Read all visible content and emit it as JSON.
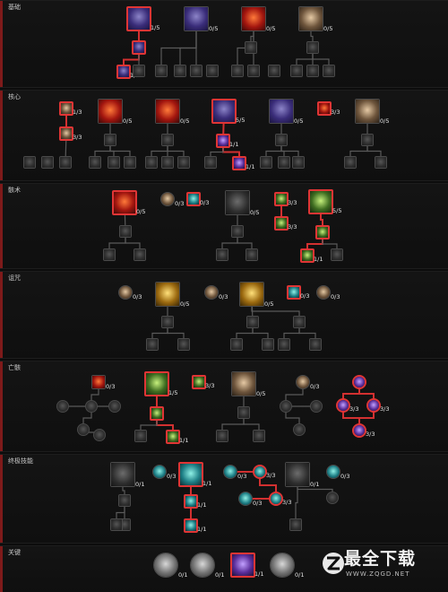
{
  "sections": [
    {
      "id": "basic",
      "title": "基础",
      "nodes": [
        {
          "id": "b1",
          "t": "blue",
          "s": "big",
          "on": true,
          "rank": "1/5"
        },
        {
          "id": "b2",
          "t": "blue",
          "s": "big",
          "rank": "0/5"
        },
        {
          "id": "b3",
          "t": "red",
          "s": "big",
          "rank": "0/5"
        },
        {
          "id": "b4",
          "t": "bronze",
          "s": "big",
          "rank": "0/5"
        },
        {
          "id": "b5",
          "t": "blue",
          "s": "med",
          "on": true
        },
        {
          "id": "b6",
          "t": "blue",
          "s": "med",
          "on": true,
          "rank": "1/1"
        },
        {
          "id": "b7",
          "t": "grey",
          "s": "small"
        },
        {
          "id": "b8",
          "t": "grey",
          "s": "small"
        },
        {
          "id": "b9",
          "t": "grey",
          "s": "small"
        },
        {
          "id": "b10",
          "t": "grey",
          "s": "small"
        },
        {
          "id": "b11",
          "t": "grey",
          "s": "small"
        },
        {
          "id": "b12",
          "t": "grey",
          "s": "small"
        },
        {
          "id": "b13",
          "t": "grey",
          "s": "small"
        },
        {
          "id": "b14",
          "t": "grey",
          "s": "small"
        },
        {
          "id": "b15",
          "t": "grey",
          "s": "small"
        },
        {
          "id": "b16",
          "t": "grey",
          "s": "small"
        },
        {
          "id": "b17",
          "t": "grey",
          "s": "small"
        },
        {
          "id": "b18",
          "t": "grey",
          "s": "small"
        },
        {
          "id": "b19",
          "t": "grey",
          "s": "small"
        }
      ]
    },
    {
      "id": "core",
      "title": "核心",
      "nodes": [
        {
          "id": "c1",
          "t": "bronze",
          "s": "med",
          "on": true,
          "rank": "1/3"
        },
        {
          "id": "c2",
          "t": "bronze",
          "s": "med",
          "on": true,
          "rank": "3/3"
        },
        {
          "id": "c3",
          "t": "red",
          "s": "big",
          "rank": "0/5"
        },
        {
          "id": "c4",
          "t": "red",
          "s": "big",
          "rank": "0/5"
        },
        {
          "id": "c5",
          "t": "blue",
          "s": "big",
          "on": true,
          "rank": "5/5"
        },
        {
          "id": "c6",
          "t": "blue",
          "s": "big",
          "rank": "0/5"
        },
        {
          "id": "c7",
          "t": "red",
          "s": "med",
          "on": true,
          "rank": "3/3"
        },
        {
          "id": "c8",
          "t": "bronze",
          "s": "big",
          "rank": "0/5"
        },
        {
          "id": "c9",
          "t": "purple",
          "s": "med",
          "on": true,
          "rank": "1/1"
        },
        {
          "id": "c10",
          "t": "purple",
          "s": "med",
          "on": true,
          "rank": "1/1"
        },
        {
          "id": "c11",
          "t": "grey",
          "s": "small"
        },
        {
          "id": "c12",
          "t": "grey",
          "s": "small"
        },
        {
          "id": "c13",
          "t": "grey",
          "s": "small"
        },
        {
          "id": "c14",
          "t": "grey",
          "s": "small"
        },
        {
          "id": "c15",
          "t": "grey",
          "s": "small"
        },
        {
          "id": "c16",
          "t": "grey",
          "s": "small"
        },
        {
          "id": "c17",
          "t": "grey",
          "s": "small"
        },
        {
          "id": "c18",
          "t": "grey",
          "s": "small"
        },
        {
          "id": "c19",
          "t": "grey",
          "s": "small"
        },
        {
          "id": "c20",
          "t": "grey",
          "s": "small"
        },
        {
          "id": "c21",
          "t": "grey",
          "s": "small"
        },
        {
          "id": "c22",
          "t": "grey",
          "s": "small"
        },
        {
          "id": "c23",
          "t": "grey",
          "s": "small"
        },
        {
          "id": "c24",
          "t": "grey",
          "s": "small"
        },
        {
          "id": "c25",
          "t": "grey",
          "s": "small"
        },
        {
          "id": "c26",
          "t": "grey",
          "s": "small"
        },
        {
          "id": "c27",
          "t": "grey",
          "s": "small"
        },
        {
          "id": "c28",
          "t": "grey",
          "s": "small"
        },
        {
          "id": "c29",
          "t": "grey",
          "s": "small"
        }
      ]
    },
    {
      "id": "arts",
      "title": "骸术",
      "nodes": [
        {
          "id": "a1",
          "t": "red",
          "s": "big",
          "on": true,
          "rank": "0/5"
        },
        {
          "id": "a2",
          "t": "bronze",
          "s": "med",
          "round": true,
          "rank": "0/3"
        },
        {
          "id": "a3",
          "t": "teal",
          "s": "med",
          "on": true,
          "rank": "0/3"
        },
        {
          "id": "a4",
          "t": "dark",
          "s": "big",
          "rank": "0/5"
        },
        {
          "id": "a5",
          "t": "green",
          "s": "med",
          "on": true,
          "rank": "3/3"
        },
        {
          "id": "a6",
          "t": "green",
          "s": "med",
          "on": true,
          "rank": "3/3"
        },
        {
          "id": "a7",
          "t": "green",
          "s": "big",
          "on": true,
          "rank": "5/5"
        },
        {
          "id": "a8",
          "t": "green",
          "s": "med",
          "on": true
        },
        {
          "id": "a9",
          "t": "green",
          "s": "med",
          "on": true,
          "rank": "1/1"
        },
        {
          "id": "a10",
          "t": "grey",
          "s": "small"
        },
        {
          "id": "a11",
          "t": "grey",
          "s": "small"
        },
        {
          "id": "a12",
          "t": "grey",
          "s": "small"
        },
        {
          "id": "a13",
          "t": "grey",
          "s": "small"
        },
        {
          "id": "a14",
          "t": "grey",
          "s": "small"
        },
        {
          "id": "a15",
          "t": "grey",
          "s": "small"
        },
        {
          "id": "a16",
          "t": "grey",
          "s": "small"
        }
      ]
    },
    {
      "id": "curse",
      "title": "诅咒",
      "nodes": [
        {
          "id": "u1",
          "t": "bronze",
          "s": "med",
          "round": true,
          "rank": "0/3"
        },
        {
          "id": "u2",
          "t": "gold",
          "s": "big",
          "rank": "0/5"
        },
        {
          "id": "u3",
          "t": "bronze",
          "s": "med",
          "round": true,
          "rank": "0/3"
        },
        {
          "id": "u4",
          "t": "gold",
          "s": "big",
          "rank": "0/5"
        },
        {
          "id": "u5",
          "t": "teal",
          "s": "med",
          "on": true,
          "rank": "0/3"
        },
        {
          "id": "u6",
          "t": "bronze",
          "s": "med",
          "round": true,
          "rank": "0/3"
        },
        {
          "id": "u7",
          "t": "grey",
          "s": "small"
        },
        {
          "id": "u8",
          "t": "grey",
          "s": "small"
        },
        {
          "id": "u9",
          "t": "grey",
          "s": "small"
        },
        {
          "id": "u10",
          "t": "grey",
          "s": "small"
        },
        {
          "id": "u11",
          "t": "grey",
          "s": "small"
        },
        {
          "id": "u12",
          "t": "grey",
          "s": "small"
        },
        {
          "id": "u13",
          "t": "grey",
          "s": "small"
        },
        {
          "id": "u14",
          "t": "grey",
          "s": "small"
        },
        {
          "id": "u15",
          "t": "grey",
          "s": "small"
        }
      ]
    },
    {
      "id": "undead",
      "title": "亡骸",
      "nodes": [
        {
          "id": "d1",
          "t": "red",
          "s": "med",
          "rank": "0/3"
        },
        {
          "id": "d2",
          "t": "green",
          "s": "big",
          "on": true,
          "rank": "1/5"
        },
        {
          "id": "d3",
          "t": "green",
          "s": "med",
          "on": true,
          "rank": "3/3"
        },
        {
          "id": "d4",
          "t": "bronze",
          "s": "big",
          "rank": "0/5"
        },
        {
          "id": "d5",
          "t": "bronze",
          "s": "med",
          "round": true,
          "rank": "0/3"
        },
        {
          "id": "d6",
          "t": "purple",
          "s": "med",
          "on": true,
          "round": true
        },
        {
          "id": "d7",
          "t": "purple",
          "s": "med",
          "on": true,
          "round": true,
          "rank": "3/3"
        },
        {
          "id": "d8",
          "t": "purple",
          "s": "med",
          "on": true,
          "round": true,
          "rank": "3/3"
        },
        {
          "id": "d9",
          "t": "purple",
          "s": "med",
          "on": true,
          "round": true,
          "rank": "3/3"
        },
        {
          "id": "d10",
          "t": "green",
          "s": "med",
          "on": true
        },
        {
          "id": "d11",
          "t": "green",
          "s": "med",
          "on": true,
          "rank": "1/1"
        },
        {
          "id": "d12",
          "t": "grey",
          "s": "small",
          "round": true
        },
        {
          "id": "d13",
          "t": "grey",
          "s": "small",
          "round": true
        },
        {
          "id": "d14",
          "t": "grey",
          "s": "small",
          "round": true
        },
        {
          "id": "d15",
          "t": "grey",
          "s": "small",
          "round": true
        },
        {
          "id": "d16",
          "t": "grey",
          "s": "small",
          "round": true
        },
        {
          "id": "d17",
          "t": "grey",
          "s": "small"
        },
        {
          "id": "d18",
          "t": "grey",
          "s": "small"
        },
        {
          "id": "d19",
          "t": "grey",
          "s": "small"
        },
        {
          "id": "d20",
          "t": "grey",
          "s": "small"
        },
        {
          "id": "d21",
          "t": "grey",
          "s": "small",
          "round": true
        },
        {
          "id": "d22",
          "t": "grey",
          "s": "small",
          "round": true
        },
        {
          "id": "d23",
          "t": "grey",
          "s": "small",
          "round": true
        }
      ]
    },
    {
      "id": "ultimate",
      "title": "终极技能",
      "nodes": [
        {
          "id": "x1",
          "t": "dark",
          "s": "big",
          "rank": "0/1"
        },
        {
          "id": "x2",
          "t": "teal",
          "s": "med",
          "round": true,
          "rank": "0/3"
        },
        {
          "id": "x3",
          "t": "teal",
          "s": "big",
          "on": true,
          "rank": "1/1"
        },
        {
          "id": "x4",
          "t": "teal",
          "s": "med",
          "round": true,
          "rank": "0/3"
        },
        {
          "id": "x5",
          "t": "teal",
          "s": "med",
          "on": true,
          "round": true,
          "rank": "3/3"
        },
        {
          "id": "x6",
          "t": "dark",
          "s": "big",
          "rank": "0/1"
        },
        {
          "id": "x7",
          "t": "teal",
          "s": "med",
          "round": true,
          "rank": "0/3"
        },
        {
          "id": "x8",
          "t": "teal",
          "s": "med",
          "round": true,
          "rank": "0/3"
        },
        {
          "id": "x9",
          "t": "teal",
          "s": "med",
          "on": true,
          "round": true,
          "rank": "3/3"
        },
        {
          "id": "x10",
          "t": "teal",
          "s": "med",
          "on": true,
          "rank": "1/1"
        },
        {
          "id": "x11",
          "t": "teal",
          "s": "med",
          "on": true,
          "rank": "1/1"
        },
        {
          "id": "x12",
          "t": "grey",
          "s": "small"
        },
        {
          "id": "x13",
          "t": "grey",
          "s": "small"
        },
        {
          "id": "x14",
          "t": "grey",
          "s": "small"
        },
        {
          "id": "x15",
          "t": "grey",
          "s": "small"
        },
        {
          "id": "x16",
          "t": "grey",
          "s": "small",
          "round": true
        }
      ]
    },
    {
      "id": "key",
      "title": "关键",
      "nodes": [
        {
          "id": "k1",
          "t": "silver",
          "s": "big",
          "round": true,
          "rank": "0/1"
        },
        {
          "id": "k2",
          "t": "silver",
          "s": "big",
          "round": true,
          "rank": "0/1"
        },
        {
          "id": "k3",
          "t": "purple",
          "s": "big",
          "on": true,
          "rank": "1/1"
        },
        {
          "id": "k4",
          "t": "silver",
          "s": "big",
          "round": true,
          "rank": "0/1"
        }
      ]
    }
  ],
  "watermark": {
    "name": "最全下载",
    "url": "WWW.ZQGD.NET"
  },
  "colors": {
    "active_border": "#e03535",
    "connector_active": "#d23030",
    "connector_inactive": "#5a5a5a",
    "section_edge": "#7e1a1a"
  }
}
